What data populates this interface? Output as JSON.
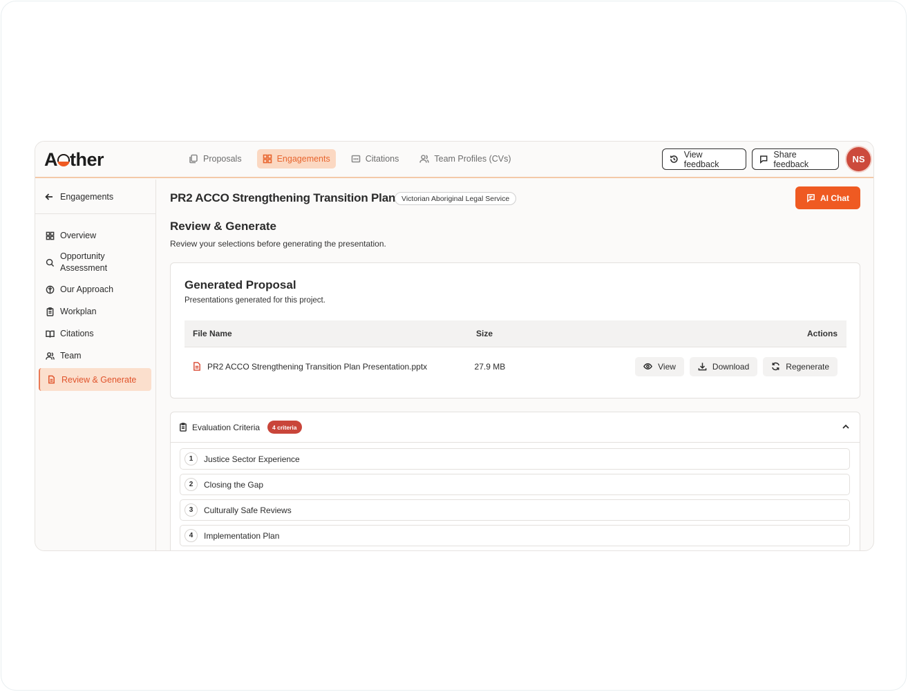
{
  "brand": {
    "logo_pre": "A",
    "logo_post": "ther",
    "accent": "#ef5a22"
  },
  "nav": [
    {
      "label": "Proposals",
      "icon": "proposals-icon",
      "active": false
    },
    {
      "label": "Engagements",
      "icon": "grid-icon",
      "active": true
    },
    {
      "label": "Citations",
      "icon": "citations-icon",
      "active": false
    },
    {
      "label": "Team Profiles (CVs)",
      "icon": "users-icon",
      "active": false
    }
  ],
  "header": {
    "view_feedback": "View feedback",
    "share_feedback": "Share feedback",
    "avatar_initials": "NS"
  },
  "sidebar": {
    "back_label": "Engagements",
    "items": [
      {
        "label": "Overview",
        "icon": "grid-icon"
      },
      {
        "label": "Opportunity Assessment",
        "icon": "search-icon"
      },
      {
        "label": "Our Approach",
        "icon": "approach-icon"
      },
      {
        "label": "Workplan",
        "icon": "clipboard-icon"
      },
      {
        "label": "Citations",
        "icon": "book-icon"
      },
      {
        "label": "Team",
        "icon": "users-icon"
      },
      {
        "label": "Review & Generate",
        "icon": "file-icon",
        "active": true
      }
    ]
  },
  "main": {
    "title": "PR2 ACCO Strengthening Transition Plan",
    "client": "Victorian Aboriginal Legal Service",
    "ai_chat": "AI Chat",
    "section_title": "Review & Generate",
    "section_sub": "Review your selections before generating the presentation."
  },
  "generated": {
    "title": "Generated Proposal",
    "subtitle": "Presentations generated for this project.",
    "columns": {
      "name": "File Name",
      "size": "Size",
      "actions": "Actions"
    },
    "file": {
      "name": "PR2 ACCO Strengthening Transition Plan Presentation.pptx",
      "size": "27.9 MB"
    },
    "actions": {
      "view": "View",
      "download": "Download",
      "regenerate": "Regenerate"
    }
  },
  "evaluation": {
    "title": "Evaluation Criteria",
    "badge": "4 criteria",
    "criteria": [
      {
        "num": "1",
        "label": "Justice Sector Experience"
      },
      {
        "num": "2",
        "label": "Closing the Gap"
      },
      {
        "num": "3",
        "label": "Culturally Safe Reviews"
      },
      {
        "num": "4",
        "label": "Implementation Plan"
      }
    ]
  }
}
